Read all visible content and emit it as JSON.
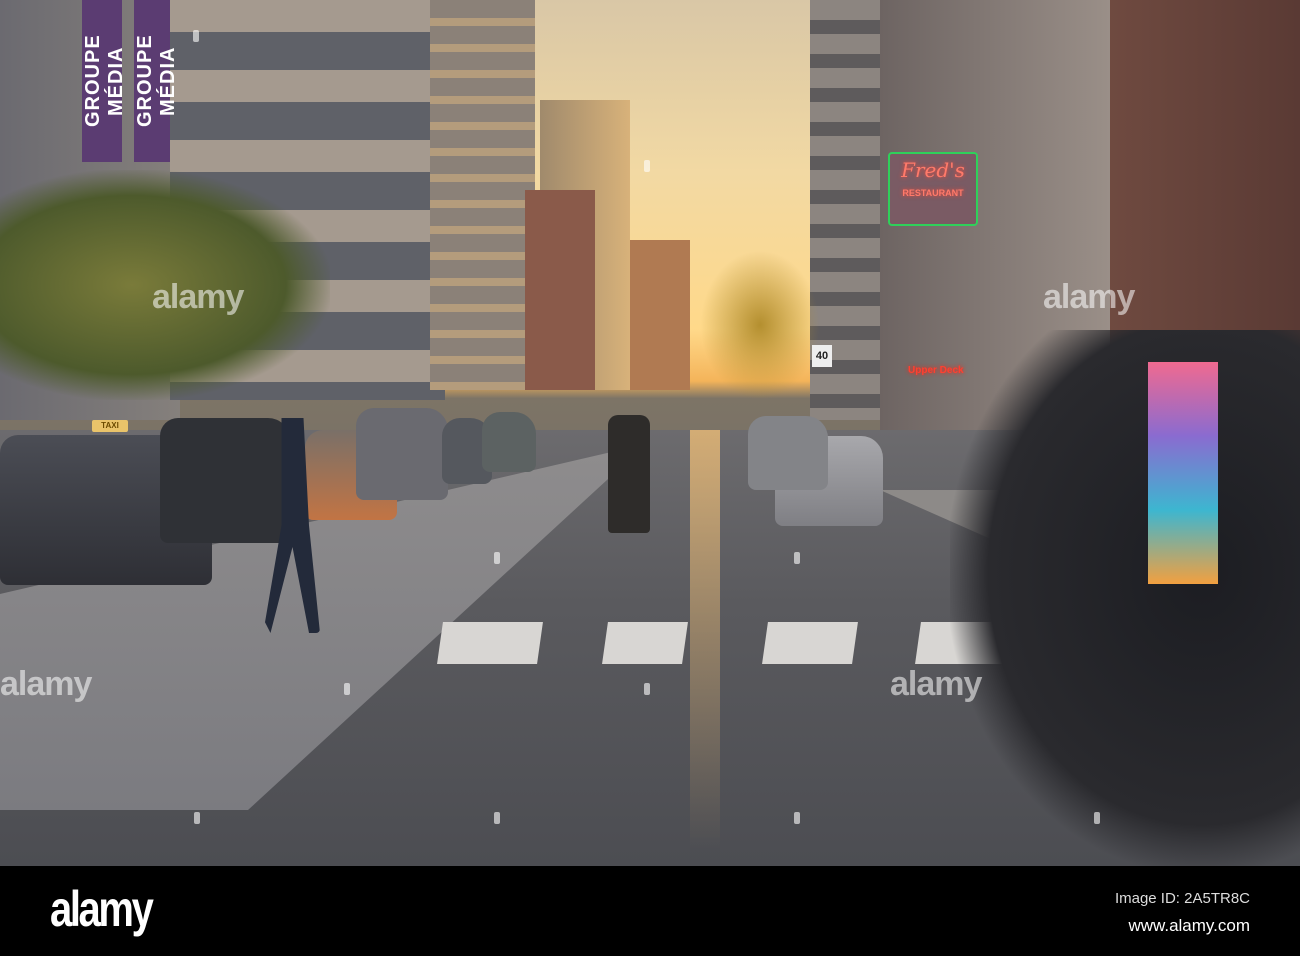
{
  "photo": {
    "banner_text": "GROUPE MÉDIA",
    "neon_sign": {
      "script": "Fred's",
      "subtitle": "RESTAURANT"
    },
    "small_neon_sign": "Upper Deck",
    "speed_limit_sign": "40",
    "taxi_sign": "TAXI",
    "watermark": "alamy"
  },
  "footer": {
    "logo": "alamy",
    "image_id": "Image ID: 2A5TR8C",
    "url": "www.alamy.com"
  }
}
